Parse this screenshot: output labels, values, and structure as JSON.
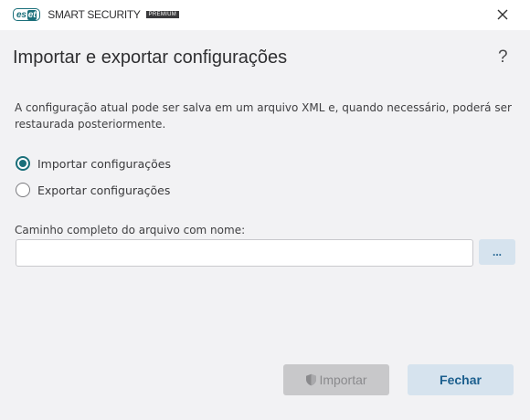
{
  "titlebar": {
    "logo_text_es": "es",
    "logo_text_et": "et",
    "product_name": "SMART SECURITY",
    "edition_badge": "PREMIUM",
    "close_icon": "close-icon"
  },
  "dialog": {
    "title": "Importar e exportar configurações",
    "help_label": "?",
    "description": "A configuração atual pode ser salva em um arquivo XML e, quando necessário, poderá ser restaurada posteriormente.",
    "options": [
      {
        "label": "Importar configurações",
        "selected": true
      },
      {
        "label": "Exportar configurações",
        "selected": false
      }
    ],
    "path_label": "Caminho completo do arquivo com nome:",
    "path_value": "",
    "browse_label": "...",
    "import_label": "Importar",
    "import_icon": "shield-icon",
    "close_label": "Fechar"
  },
  "colors": {
    "brand": "#1b6f7a",
    "accent_button_bg": "#d6e3ee",
    "accent_button_text": "#1c5f8e",
    "disabled_button_bg": "#c8c8ca"
  }
}
